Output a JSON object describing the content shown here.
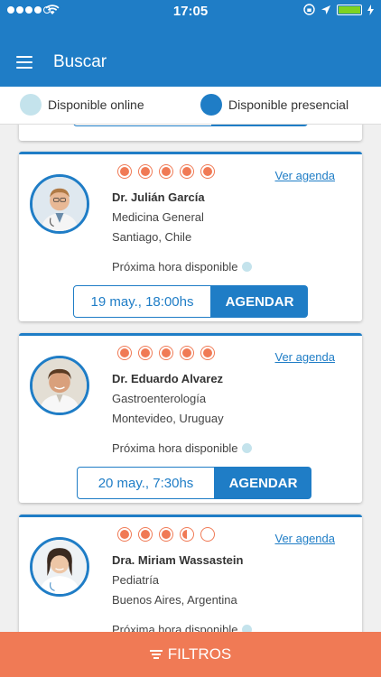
{
  "status_bar": {
    "time": "17:05"
  },
  "header": {
    "title": "Buscar",
    "menu_icon": "menu-icon"
  },
  "legend": {
    "online_label": "Disponible online",
    "presencial_label": "Disponible presencial",
    "online_color": "#c4e3ec",
    "presencial_color": "#1f7dc6"
  },
  "doctors": [
    {
      "name": "Dr. Julián García",
      "specialty": "Medicina General",
      "location": "Santiago, Chile",
      "rating": 5,
      "agenda_link": "Ver agenda",
      "next_label": "Próxima hora disponible",
      "date": "19 may., 18:00hs",
      "button": "AGENDAR"
    },
    {
      "name": "Dr. Eduardo Alvarez",
      "specialty": "Gastroenterología",
      "location": "Montevideo, Uruguay",
      "rating": 5,
      "agenda_link": "Ver agenda",
      "next_label": "Próxima hora disponible",
      "date": "20 may., 7:30hs",
      "button": "AGENDAR"
    },
    {
      "name": "Dra. Miriam Wassastein",
      "specialty": "Pediatría",
      "location": "Buenos Aires, Argentina",
      "rating": 3.5,
      "agenda_link": "Ver agenda",
      "next_label": "Próxima hora disponible",
      "date": "",
      "button": ""
    }
  ],
  "filter": {
    "label": "FILTROS"
  },
  "colors": {
    "primary": "#1f7dc6",
    "accent": "#f07a55"
  }
}
